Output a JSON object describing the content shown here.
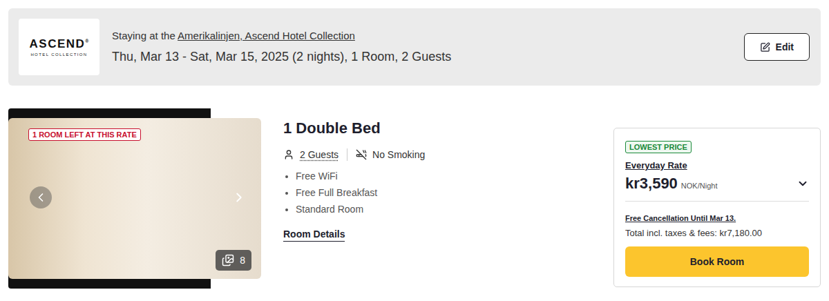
{
  "hotel_banner": {
    "logo": {
      "name": "ASCEND",
      "mark": "®",
      "subtitle": "HOTEL COLLECTION"
    },
    "staying_prefix": "Staying at the",
    "hotel_name": "Amerikalinjen, Ascend Hotel Collection",
    "dates": "Thu, Mar 13 - Sat, Mar 15, 2025 (2 nights), 1 Room, 2 Guests",
    "edit_button": "Edit"
  },
  "room": {
    "photo": {
      "badge": "1 ROOM LEFT AT THIS RATE",
      "count": "8"
    },
    "title": "1 Double Bed",
    "guests": "2 Guests",
    "smoking": "No Smoking",
    "amenities": [
      "Free WiFi",
      "Free Full Breakfast",
      "Standard Room"
    ],
    "details_link": "Room Details"
  },
  "rate": {
    "badge": "LOWEST PRICE",
    "name": "Everyday Rate",
    "price": "kr3,590",
    "unit": "NOK/Night",
    "expanded": false,
    "cancellation": "Free Cancellation Until Mar 13.",
    "total": "Total incl. taxes & fees: kr7,180.00",
    "button": "Book Room"
  }
}
